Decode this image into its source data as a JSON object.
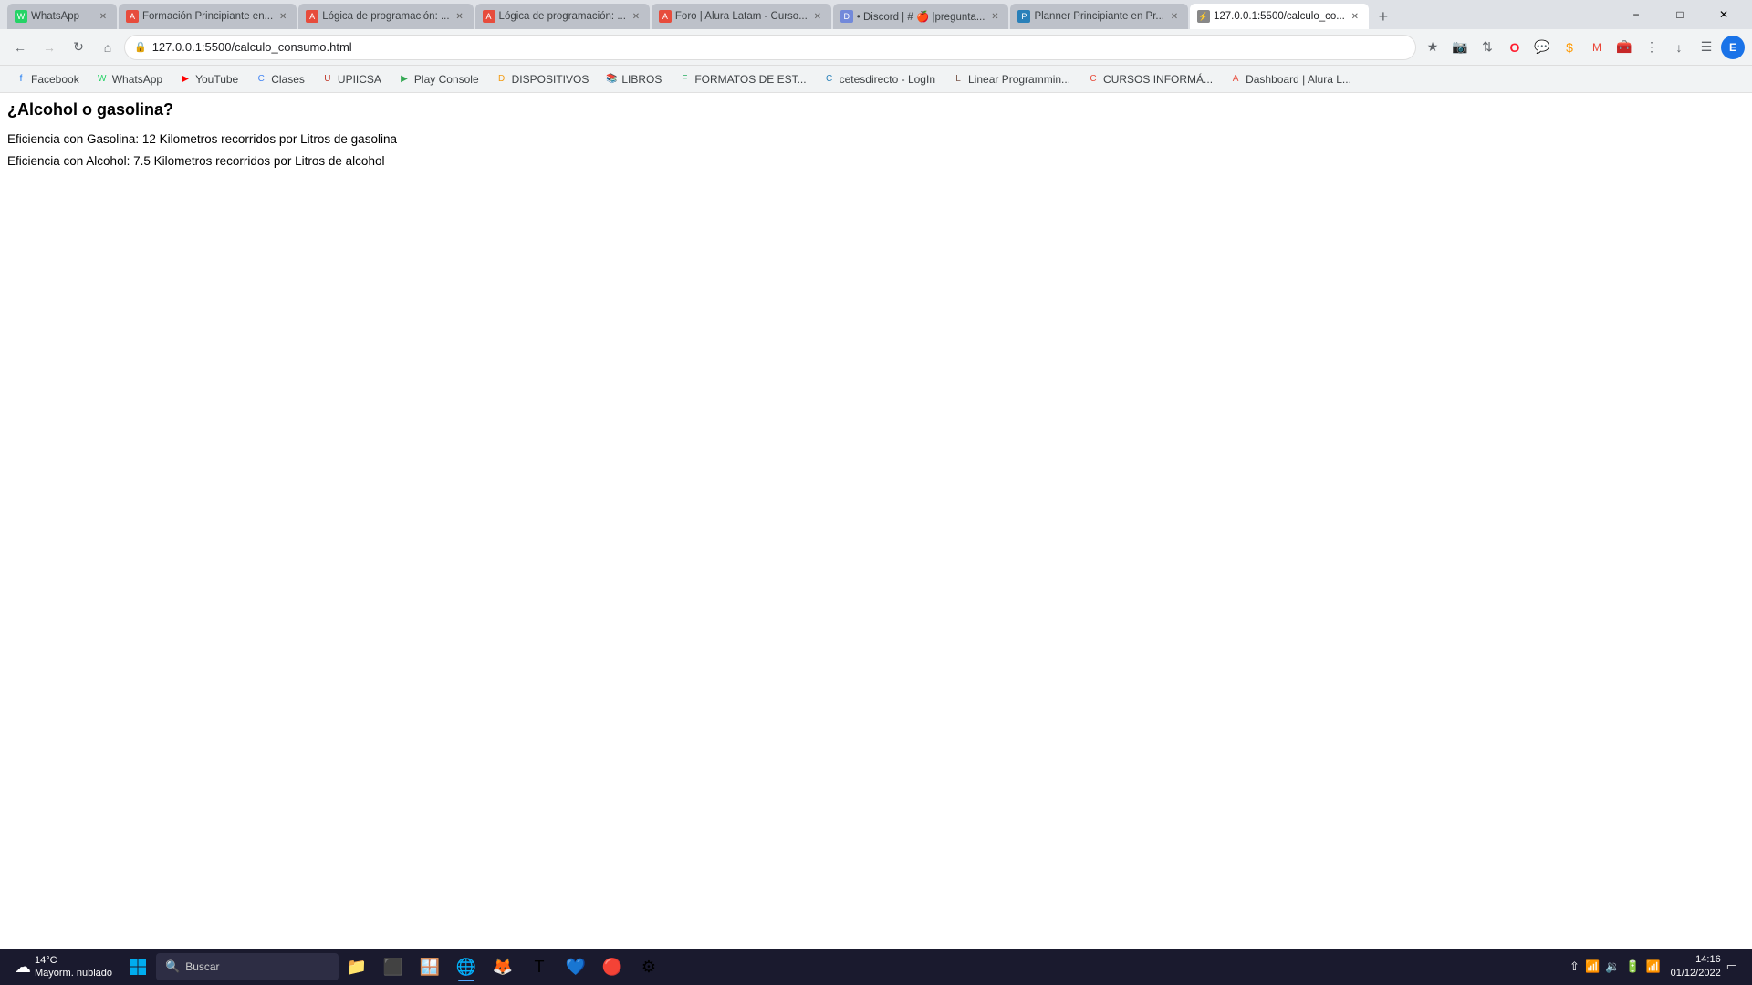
{
  "browser": {
    "tabs": [
      {
        "id": "tab1",
        "title": "WhatsApp",
        "favicon_color": "#25d366",
        "favicon_text": "W",
        "active": false
      },
      {
        "id": "tab2",
        "title": "Formación Principiante en...",
        "favicon_color": "#e74c3c",
        "favicon_text": "A",
        "active": false
      },
      {
        "id": "tab3",
        "title": "Lógica de programación: ...",
        "favicon_color": "#e74c3c",
        "favicon_text": "A",
        "active": false
      },
      {
        "id": "tab4",
        "title": "Lógica de programación: ...",
        "favicon_color": "#e74c3c",
        "favicon_text": "A",
        "active": false
      },
      {
        "id": "tab5",
        "title": "Foro | Alura Latam - Curso...",
        "favicon_color": "#e74c3c",
        "favicon_text": "A",
        "active": false
      },
      {
        "id": "tab6",
        "title": "• Discord | # 🍎 |pregunta...",
        "favicon_color": "#7289da",
        "favicon_text": "D",
        "active": false
      },
      {
        "id": "tab7",
        "title": "Planner Principiante en Pr...",
        "favicon_color": "#2980b9",
        "favicon_text": "P",
        "active": false
      },
      {
        "id": "tab8",
        "title": "127.0.0.1:5500/calculo_co...",
        "favicon_color": "#888",
        "favicon_text": "⚡",
        "active": true
      }
    ],
    "url": "127.0.0.1:5500/calculo_consumo.html",
    "new_tab_label": "+",
    "close_label": "✕"
  },
  "nav": {
    "back_disabled": false,
    "forward_disabled": true
  },
  "bookmarks": [
    {
      "label": "Facebook",
      "favicon": "f",
      "color": "#1877f2"
    },
    {
      "label": "WhatsApp",
      "favicon": "W",
      "color": "#25d366"
    },
    {
      "label": "YouTube",
      "favicon": "▶",
      "color": "#ff0000"
    },
    {
      "label": "Clases",
      "favicon": "C",
      "color": "#4285f4"
    },
    {
      "label": "UPIICSA",
      "favicon": "U",
      "color": "#c0392b"
    },
    {
      "label": "Play Console",
      "favicon": "▶",
      "color": "#34a853"
    },
    {
      "label": "DISPOSITIVOS",
      "favicon": "D",
      "color": "#f39c12"
    },
    {
      "label": "LIBROS",
      "favicon": "📚",
      "color": "#8e44ad"
    },
    {
      "label": "FORMATOS DE EST...",
      "favicon": "F",
      "color": "#27ae60"
    },
    {
      "label": "cetesdirecto - LogIn",
      "favicon": "C",
      "color": "#2980b9"
    },
    {
      "label": "Linear Programmin...",
      "favicon": "L",
      "color": "#795548"
    },
    {
      "label": "CURSOS INFORMÁ...",
      "favicon": "C",
      "color": "#e74c3c"
    },
    {
      "label": "Dashboard | Alura L...",
      "favicon": "A",
      "color": "#e74c3c"
    }
  ],
  "page": {
    "heading": "¿Alcohol o gasolina?",
    "line1": "Eficiencia con Gasolina: 12 Kilometros recorridos por Litros de gasolina",
    "line2": "Eficiencia con Alcohol: 7.5 Kilometros recorridos por Litros de alcohol"
  },
  "taskbar": {
    "weather": {
      "icon": "☁",
      "temp": "14°C",
      "condition": "Mayorm. nublado"
    },
    "search_placeholder": "Buscar",
    "apps": [
      {
        "name": "File Explorer",
        "icon": "📁",
        "active": false
      },
      {
        "name": "Terminal",
        "icon": "⬛",
        "active": false
      },
      {
        "name": "Windows Store",
        "icon": "🪟",
        "active": false
      },
      {
        "name": "Chrome",
        "icon": "🌐",
        "active": true
      },
      {
        "name": "Firefox",
        "icon": "🦊",
        "active": false
      },
      {
        "name": "Teams",
        "icon": "T",
        "active": false
      },
      {
        "name": "VS Code",
        "icon": "💙",
        "active": false
      },
      {
        "name": "App7",
        "icon": "🔴",
        "active": false
      },
      {
        "name": "App8",
        "icon": "⚙",
        "active": false
      }
    ],
    "clock": {
      "time": "14:16",
      "date": "01/12/2022"
    }
  }
}
